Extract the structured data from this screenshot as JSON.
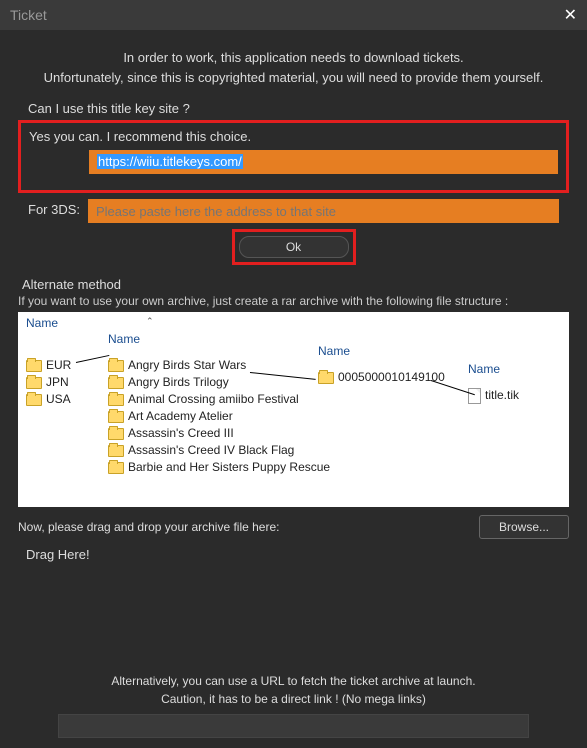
{
  "titlebar": {
    "title": "Ticket",
    "close": "✕"
  },
  "intro": {
    "line1": "In order to work, this application needs to download tickets.",
    "line2": "Unfortunately, since this is copyrighted material, you will need to provide them yourself."
  },
  "section1": {
    "question": "Can I use this title key site ?",
    "recommend": "Yes you can. I recommend this choice.",
    "wiiu_url": "https://wiiu.titlekeys.com/",
    "for3ds_label": "For 3DS:",
    "for3ds_placeholder": "Please paste here the address to that site",
    "ok": "Ok"
  },
  "alternate": {
    "title": "Alternate method",
    "desc": "If you want to use your own archive, just create a rar archive with the following file structure :",
    "col1_header": "Name",
    "col2_header": "Name",
    "col3_header": "Name",
    "col4_header": "Name",
    "regions": [
      "EUR",
      "JPN",
      "USA"
    ],
    "games": [
      "Angry Birds Star Wars",
      "Angry Birds Trilogy",
      "Animal Crossing amiibo Festival",
      "Art Academy Atelier",
      "Assassin's Creed III",
      "Assassin's Creed IV Black Flag",
      "Barbie and Her Sisters Puppy Rescue"
    ],
    "titleid": "0005000010149100",
    "tikfile": "title.tik"
  },
  "drop": {
    "label": "Now, please drag and drop your archive file here:",
    "browse": "Browse...",
    "drag": "Drag Here!"
  },
  "bottom": {
    "line1": "Alternatively, you can use a URL to fetch the ticket archive at launch.",
    "line2": "Caution, it has to be a direct link ! (No mega links)"
  }
}
